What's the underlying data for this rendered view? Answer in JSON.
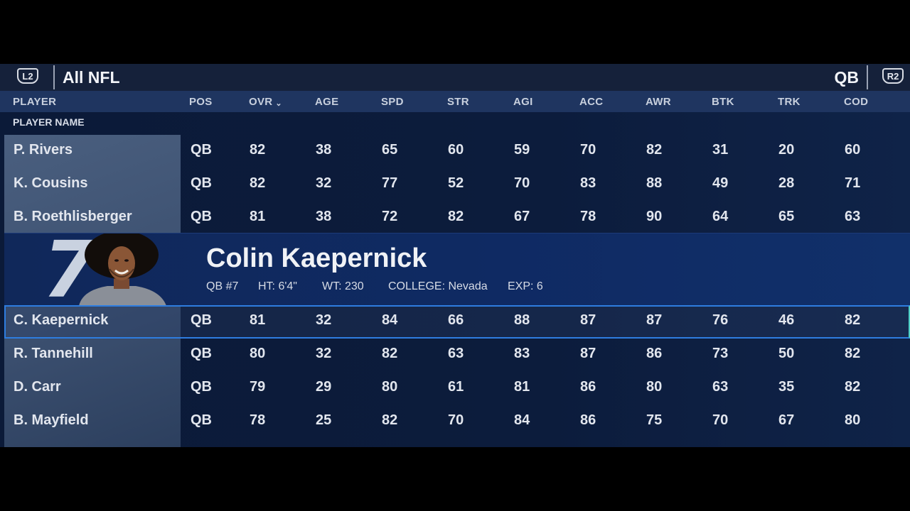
{
  "topbar": {
    "left_trigger": "L2",
    "right_trigger": "R2",
    "filter_title": "All NFL",
    "position_filter": "QB"
  },
  "columns": [
    "PLAYER",
    "POS",
    "OVR",
    "AGE",
    "SPD",
    "STR",
    "AGI",
    "ACC",
    "AWR",
    "BTK",
    "TRK",
    "COD"
  ],
  "sort_indicator": "chevron-down-icon",
  "subheader": "PLAYER NAME",
  "rows": [
    {
      "name": "P. Rivers",
      "pos": "QB",
      "ovr": "82",
      "age": "38",
      "spd": "65",
      "str": "60",
      "agi": "59",
      "acc": "70",
      "awr": "82",
      "btk": "31",
      "trk": "20",
      "cod": "60"
    },
    {
      "name": "K. Cousins",
      "pos": "QB",
      "ovr": "82",
      "age": "32",
      "spd": "77",
      "str": "52",
      "agi": "70",
      "acc": "83",
      "awr": "88",
      "btk": "49",
      "trk": "28",
      "cod": "71"
    },
    {
      "name": "B. Roethlisberger",
      "pos": "QB",
      "ovr": "81",
      "age": "38",
      "spd": "72",
      "str": "82",
      "agi": "67",
      "acc": "78",
      "awr": "90",
      "btk": "64",
      "trk": "65",
      "cod": "63"
    },
    {
      "name": "C. Kaepernick",
      "pos": "QB",
      "ovr": "81",
      "age": "32",
      "spd": "84",
      "str": "66",
      "agi": "88",
      "acc": "87",
      "awr": "87",
      "btk": "76",
      "trk": "46",
      "cod": "82"
    },
    {
      "name": "R. Tannehill",
      "pos": "QB",
      "ovr": "80",
      "age": "32",
      "spd": "82",
      "str": "63",
      "agi": "83",
      "acc": "87",
      "awr": "86",
      "btk": "73",
      "trk": "50",
      "cod": "82"
    },
    {
      "name": "D. Carr",
      "pos": "QB",
      "ovr": "79",
      "age": "29",
      "spd": "80",
      "str": "61",
      "agi": "81",
      "acc": "86",
      "awr": "80",
      "btk": "63",
      "trk": "35",
      "cod": "82"
    },
    {
      "name": "B. Mayfield",
      "pos": "QB",
      "ovr": "78",
      "age": "25",
      "spd": "82",
      "str": "70",
      "agi": "84",
      "acc": "86",
      "awr": "75",
      "btk": "70",
      "trk": "67",
      "cod": "80"
    }
  ],
  "selected_index": 3,
  "featured": {
    "jersey": "7",
    "name": "Colin Kaepernick",
    "pos_num": "QB #7",
    "height": "HT: 6'4\"",
    "weight": "WT: 230",
    "college": "COLLEGE: Nevada",
    "exp": "EXP: 6"
  },
  "colors": {
    "selection_border": "#2e7de0",
    "header_bg": "#1f3560",
    "panel_bg": "#0c1c3c"
  }
}
